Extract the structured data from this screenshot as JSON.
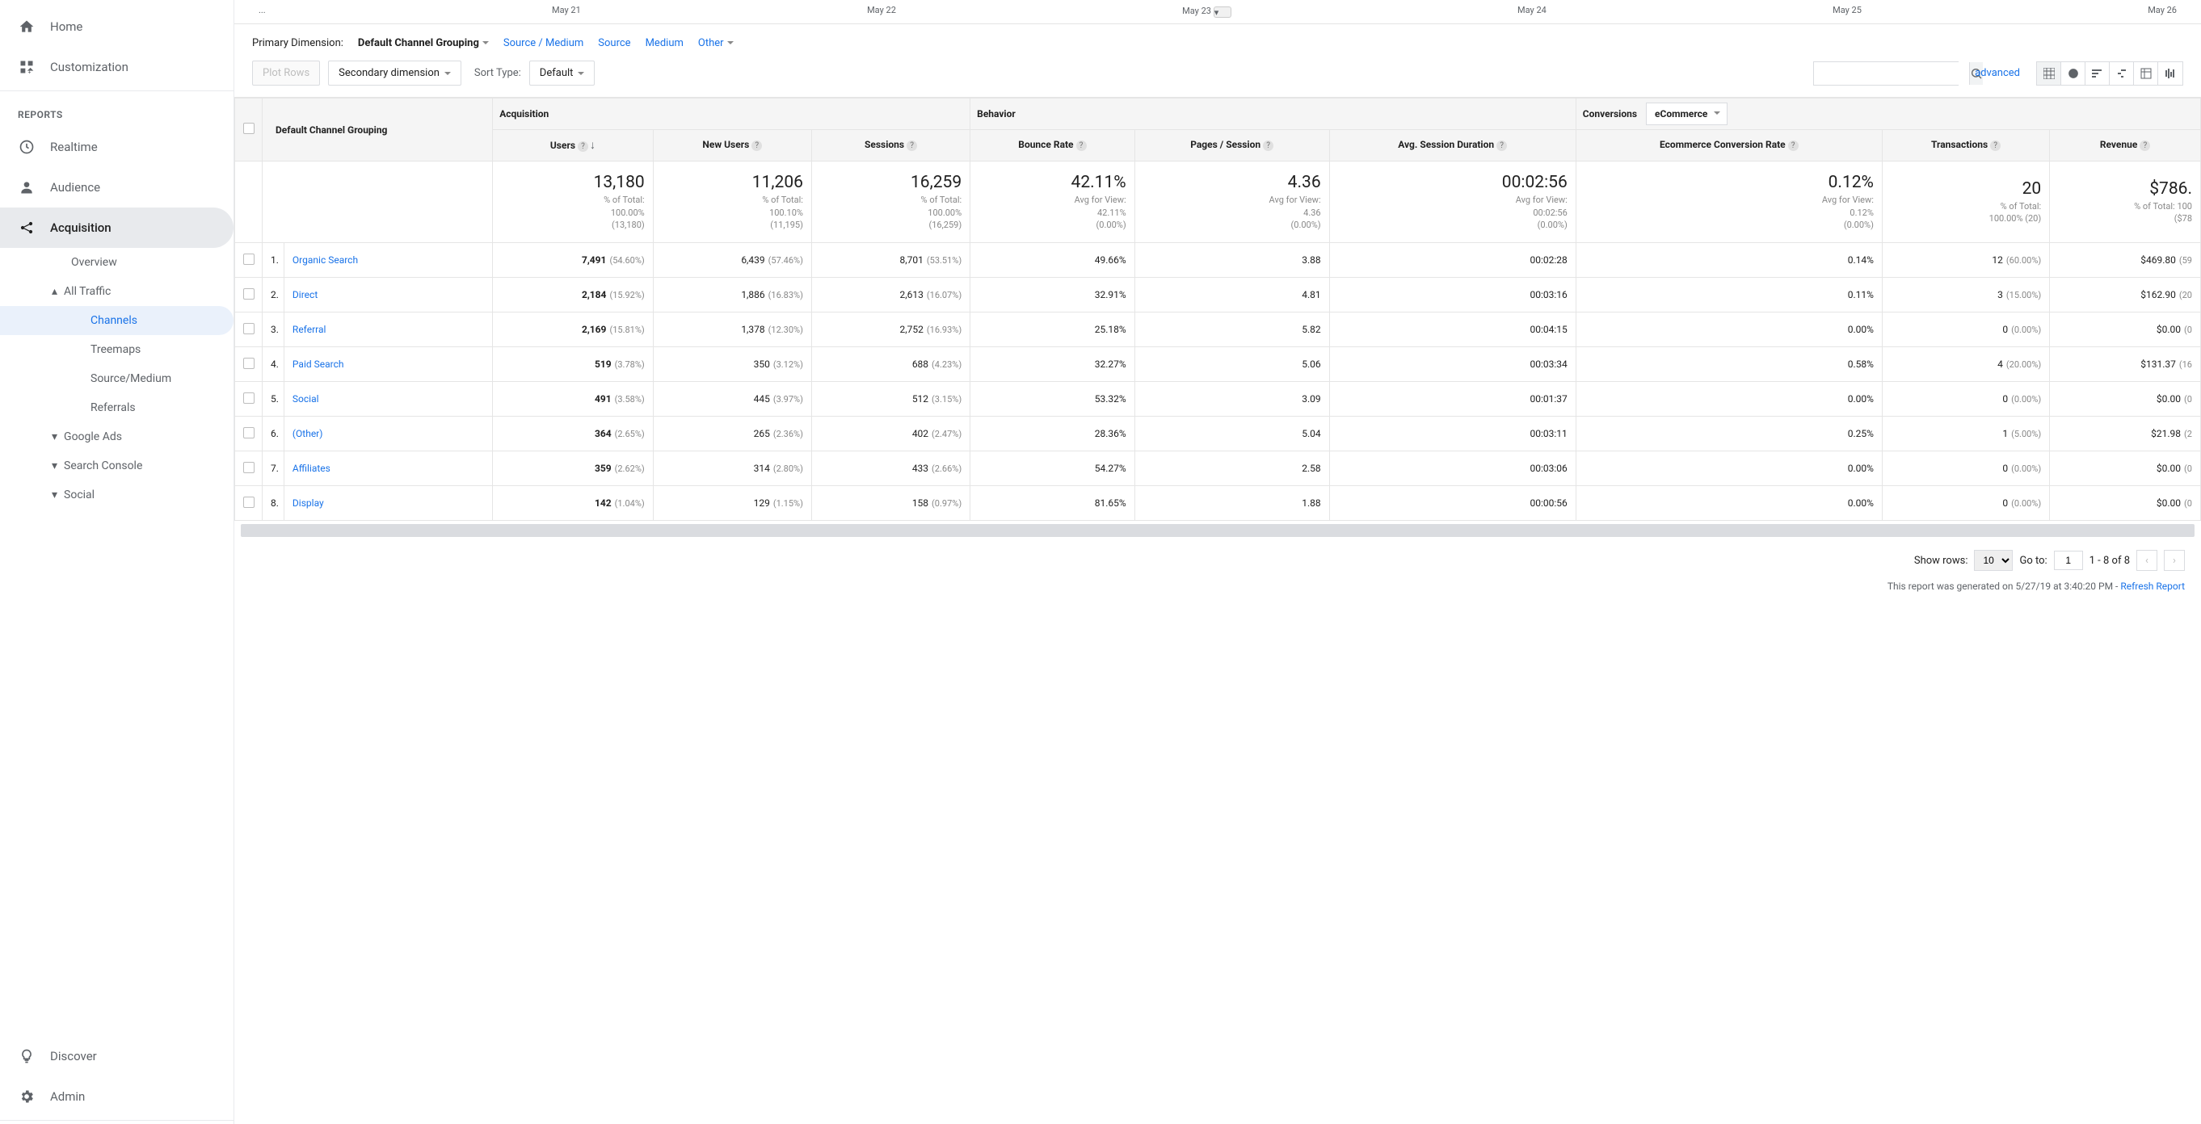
{
  "sidebar": {
    "home": "Home",
    "customization": "Customization",
    "reports_label": "REPORTS",
    "realtime": "Realtime",
    "audience": "Audience",
    "acquisition": "Acquisition",
    "acq_sub": {
      "overview": "Overview",
      "all_traffic": "All Traffic",
      "channels": "Channels",
      "treemaps": "Treemaps",
      "source_medium": "Source/Medium",
      "referrals": "Referrals",
      "google_ads": "Google Ads",
      "search_console": "Search Console",
      "social": "Social"
    },
    "discover": "Discover",
    "admin": "Admin"
  },
  "timeline": {
    "ellipsis": "...",
    "d1": "May 21",
    "d2": "May 22",
    "d3": "May 23",
    "d4": "May 24",
    "d5": "May 25",
    "d6": "May 26"
  },
  "dimbar": {
    "label": "Primary Dimension:",
    "active": "Default Channel Grouping",
    "source_medium": "Source / Medium",
    "source": "Source",
    "medium": "Medium",
    "other": "Other"
  },
  "controls": {
    "plot_rows": "Plot Rows",
    "secondary_dim": "Secondary dimension",
    "sort_type": "Sort Type:",
    "default": "Default",
    "advanced": "advanced"
  },
  "table": {
    "dim_header": "Default Channel Grouping",
    "groups": {
      "acquisition": "Acquisition",
      "behavior": "Behavior",
      "conversions": "Conversions"
    },
    "conv_select": "eCommerce",
    "cols": {
      "users": "Users",
      "new_users": "New Users",
      "sessions": "Sessions",
      "bounce": "Bounce Rate",
      "pages": "Pages / Session",
      "avg_dur": "Avg. Session Duration",
      "ecr": "Ecommerce Conversion Rate",
      "trans": "Transactions",
      "revenue": "Revenue"
    },
    "summary": {
      "users": {
        "big": "13,180",
        "sub1": "% of Total:",
        "sub2": "100.00%",
        "sub3": "(13,180)"
      },
      "new_users": {
        "big": "11,206",
        "sub1": "% of Total:",
        "sub2": "100.10%",
        "sub3": "(11,195)"
      },
      "sessions": {
        "big": "16,259",
        "sub1": "% of Total:",
        "sub2": "100.00%",
        "sub3": "(16,259)"
      },
      "bounce": {
        "big": "42.11%",
        "sub1": "Avg for View:",
        "sub2": "42.11%",
        "sub3": "(0.00%)"
      },
      "pages": {
        "big": "4.36",
        "sub1": "Avg for View:",
        "sub2": "4.36",
        "sub3": "(0.00%)"
      },
      "avg_dur": {
        "big": "00:02:56",
        "sub1": "Avg for View:",
        "sub2": "00:02:56",
        "sub3": "(0.00%)"
      },
      "ecr": {
        "big": "0.12%",
        "sub1": "Avg for View:",
        "sub2": "0.12%",
        "sub3": "(0.00%)"
      },
      "trans": {
        "big": "20",
        "sub1": "% of Total:",
        "sub2": "100.00% (20)"
      },
      "revenue": {
        "big": "$786.",
        "sub1": "% of Total: 100",
        "sub2": "($78"
      }
    },
    "rows": [
      {
        "idx": "1.",
        "name": "Organic Search",
        "users": "7,491",
        "users_pct": "(54.60%)",
        "new_users": "6,439",
        "new_users_pct": "(57.46%)",
        "sessions": "8,701",
        "sessions_pct": "(53.51%)",
        "bounce": "49.66%",
        "pages": "3.88",
        "dur": "00:02:28",
        "ecr": "0.14%",
        "trans": "12",
        "trans_pct": "(60.00%)",
        "rev": "$469.80",
        "rev_pct": "(59"
      },
      {
        "idx": "2.",
        "name": "Direct",
        "users": "2,184",
        "users_pct": "(15.92%)",
        "new_users": "1,886",
        "new_users_pct": "(16.83%)",
        "sessions": "2,613",
        "sessions_pct": "(16.07%)",
        "bounce": "32.91%",
        "pages": "4.81",
        "dur": "00:03:16",
        "ecr": "0.11%",
        "trans": "3",
        "trans_pct": "(15.00%)",
        "rev": "$162.90",
        "rev_pct": "(20"
      },
      {
        "idx": "3.",
        "name": "Referral",
        "users": "2,169",
        "users_pct": "(15.81%)",
        "new_users": "1,378",
        "new_users_pct": "(12.30%)",
        "sessions": "2,752",
        "sessions_pct": "(16.93%)",
        "bounce": "25.18%",
        "pages": "5.82",
        "dur": "00:04:15",
        "ecr": "0.00%",
        "trans": "0",
        "trans_pct": "(0.00%)",
        "rev": "$0.00",
        "rev_pct": "(0"
      },
      {
        "idx": "4.",
        "name": "Paid Search",
        "users": "519",
        "users_pct": "(3.78%)",
        "new_users": "350",
        "new_users_pct": "(3.12%)",
        "sessions": "688",
        "sessions_pct": "(4.23%)",
        "bounce": "32.27%",
        "pages": "5.06",
        "dur": "00:03:34",
        "ecr": "0.58%",
        "trans": "4",
        "trans_pct": "(20.00%)",
        "rev": "$131.37",
        "rev_pct": "(16"
      },
      {
        "idx": "5.",
        "name": "Social",
        "users": "491",
        "users_pct": "(3.58%)",
        "new_users": "445",
        "new_users_pct": "(3.97%)",
        "sessions": "512",
        "sessions_pct": "(3.15%)",
        "bounce": "53.32%",
        "pages": "3.09",
        "dur": "00:01:37",
        "ecr": "0.00%",
        "trans": "0",
        "trans_pct": "(0.00%)",
        "rev": "$0.00",
        "rev_pct": "(0"
      },
      {
        "idx": "6.",
        "name": "(Other)",
        "users": "364",
        "users_pct": "(2.65%)",
        "new_users": "265",
        "new_users_pct": "(2.36%)",
        "sessions": "402",
        "sessions_pct": "(2.47%)",
        "bounce": "28.36%",
        "pages": "5.04",
        "dur": "00:03:11",
        "ecr": "0.25%",
        "trans": "1",
        "trans_pct": "(5.00%)",
        "rev": "$21.98",
        "rev_pct": "(2"
      },
      {
        "idx": "7.",
        "name": "Affiliates",
        "users": "359",
        "users_pct": "(2.62%)",
        "new_users": "314",
        "new_users_pct": "(2.80%)",
        "sessions": "433",
        "sessions_pct": "(2.66%)",
        "bounce": "54.27%",
        "pages": "2.58",
        "dur": "00:03:06",
        "ecr": "0.00%",
        "trans": "0",
        "trans_pct": "(0.00%)",
        "rev": "$0.00",
        "rev_pct": "(0"
      },
      {
        "idx": "8.",
        "name": "Display",
        "users": "142",
        "users_pct": "(1.04%)",
        "new_users": "129",
        "new_users_pct": "(1.15%)",
        "sessions": "158",
        "sessions_pct": "(0.97%)",
        "bounce": "81.65%",
        "pages": "1.88",
        "dur": "00:00:56",
        "ecr": "0.00%",
        "trans": "0",
        "trans_pct": "(0.00%)",
        "rev": "$0.00",
        "rev_pct": "(0"
      }
    ]
  },
  "footer": {
    "show_rows": "Show rows:",
    "rows_val": "10",
    "go_to": "Go to:",
    "go_val": "1",
    "range": "1 - 8 of 8",
    "note": "This report was generated on 5/27/19 at 3:40:20 PM - ",
    "refresh": "Refresh Report"
  }
}
